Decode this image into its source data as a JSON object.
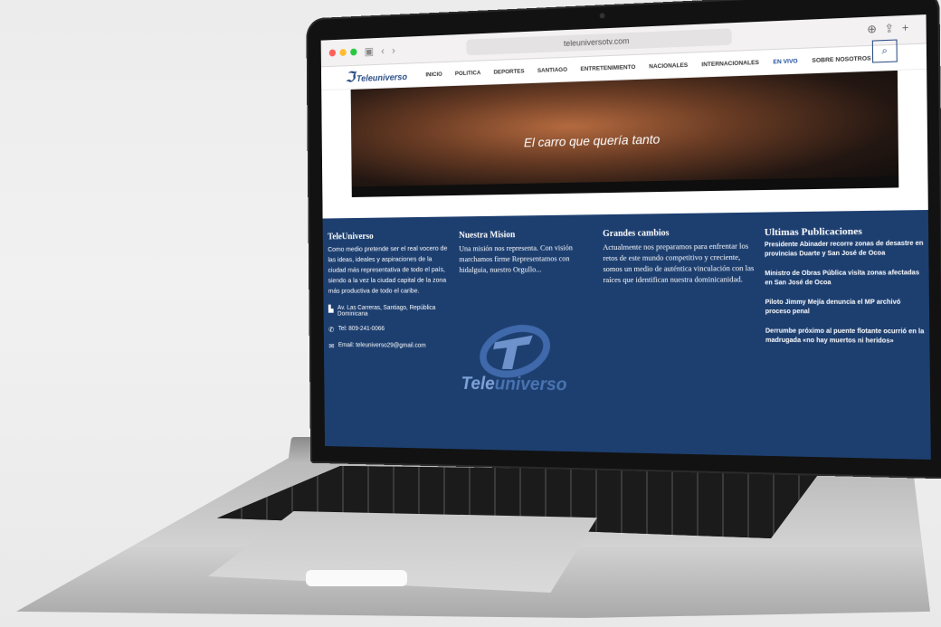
{
  "browser": {
    "url": "teleuniversotv.com",
    "traffic_lights": [
      "#ff5f57",
      "#febc2e",
      "#28c840"
    ]
  },
  "site": {
    "logo_text": "Teleuniverso",
    "nav": [
      "INICIO",
      "POLITICA",
      "DEPORTES",
      "SANTIAGO",
      "ENTRETENIMIENTO",
      "NACIONALES",
      "INTERNACIONALES",
      "EN VIVO",
      "SOBRE NOSOTROS"
    ],
    "hero_caption": "El carro que quería tanto"
  },
  "footer": {
    "col1": {
      "title": "TeleUniverso",
      "text": "Como medio pretende ser el real vocero de las ideas, ideales y aspiraciones de la ciudad más representativa de todo el país, siendo a la vez la ciudad capital de la zona más productiva de todo el caribe.",
      "address": "Av. Las Carreras, Santiago, República Dominicana",
      "phone": "Tel: 809-241-0066",
      "email": "Email: teleuniverso29@gmail.com"
    },
    "col2": {
      "title": "Nuestra Mision",
      "text": "Una misión nos representa. Con visión marchamos firme Representamos con hidalguia, nuestro Orgullo..."
    },
    "col3": {
      "title": "Grandes cambios",
      "text": "Actualmente nos preparamos para enfrentar los retos de este mundo competitivo y creciente, somos un medio de auténtica vinculación con las raíces que identifican nuestra dominicanidad."
    },
    "col4": {
      "title": "Ultimas Publicaciones",
      "items": [
        "Presidente Abinader recorre zonas de desastre en provincias Duarte y San José de Ocoa",
        "Ministro de Obras Pública visita zonas afectadas en San José de Ocoa",
        "Piloto Jimmy Mejía denuncia el MP archivó proceso penal",
        "Derrumbe próximo al puente flotante ocurrió en la madrugada «no hay muertos ni heridos»"
      ]
    },
    "logo": {
      "part1": "Tele",
      "part2": "universo"
    }
  }
}
